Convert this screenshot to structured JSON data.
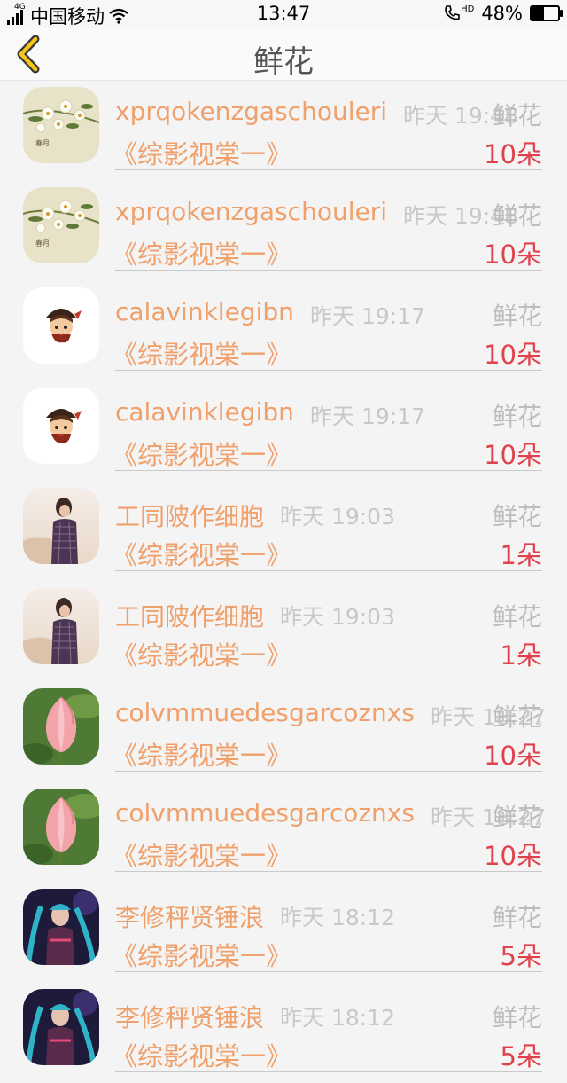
{
  "status_bar": {
    "network": "4G",
    "carrier": "中国移动",
    "time": "13:47",
    "call_icon": "HD",
    "battery": "48%",
    "battery_level": 0.48
  },
  "header": {
    "back_icon": "chevron-left-icon",
    "title": "鲜花"
  },
  "rows": [
    {
      "name": "xprqokenzgaschouleri",
      "time": "昨天 19:48",
      "type": "鲜花",
      "book": "《综影视棠一》",
      "count": "10朵",
      "avatar": "flower-painting"
    },
    {
      "name": "xprqokenzgaschouleri",
      "time": "昨天 19:48",
      "type": "鲜花",
      "book": "《综影视棠一》",
      "count": "10朵",
      "avatar": "flower-painting"
    },
    {
      "name": "calavinklegibn",
      "time": "昨天 19:17",
      "type": "鲜花",
      "book": "《综影视棠一》",
      "count": "10朵",
      "avatar": "cartoon-pirate"
    },
    {
      "name": "calavinklegibn",
      "time": "昨天 19:17",
      "type": "鲜花",
      "book": "《综影视棠一》",
      "count": "10朵",
      "avatar": "cartoon-pirate"
    },
    {
      "name": "工同陂作细胞",
      "time": "昨天 19:03",
      "type": "鲜花",
      "book": "《综影视棠一》",
      "count": "1朵",
      "avatar": "person-photo"
    },
    {
      "name": "工同陂作细胞",
      "time": "昨天 19:03",
      "type": "鲜花",
      "book": "《综影视棠一》",
      "count": "1朵",
      "avatar": "person-photo"
    },
    {
      "name": "colvmmuedesgarcoznxs",
      "time": "昨天 18:27",
      "type": "鲜花",
      "book": "《综影视棠一》",
      "count": "10朵",
      "avatar": "lotus-bud"
    },
    {
      "name": "colvmmuedesgarcoznxs",
      "time": "昨天 18:27",
      "type": "鲜花",
      "book": "《综影视棠一》",
      "count": "10朵",
      "avatar": "lotus-bud"
    },
    {
      "name": "李修秤贤锤浪",
      "time": "昨天 18:12",
      "type": "鲜花",
      "book": "《综影视棠一》",
      "count": "5朵",
      "avatar": "game-character"
    },
    {
      "name": "李修秤贤锤浪",
      "time": "昨天 18:12",
      "type": "鲜花",
      "book": "《综影视棠一》",
      "count": "5朵",
      "avatar": "game-character"
    }
  ]
}
